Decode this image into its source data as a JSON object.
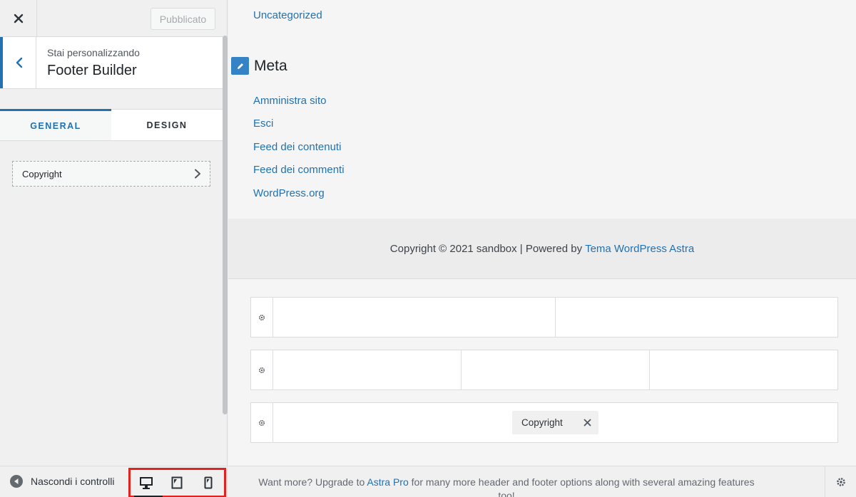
{
  "sidebar": {
    "publish_label": "Pubblicato",
    "section_sub": "Stai personalizzando",
    "section_title": "Footer Builder",
    "tabs": [
      {
        "label": "GENERAL",
        "active": true
      },
      {
        "label": "DESIGN",
        "active": false
      }
    ],
    "items": [
      {
        "label": "Copyright"
      }
    ],
    "hide_controls_label": "Nascondi i controlli"
  },
  "preview": {
    "category_link": "Uncategorized",
    "meta_heading": "Meta",
    "meta_links": [
      "Amministra sito",
      "Esci",
      "Feed dei contenuti",
      "Feed dei commenti",
      "WordPress.org"
    ],
    "footer_text": "Copyright © 2021 sandbox | Powered by",
    "footer_link": "Tema WordPress Astra",
    "builder_chip_label": "Copyright"
  },
  "promo": {
    "text_before": "Want more? Upgrade to",
    "link": "Astra Pro",
    "text_after": "for many more header and footer options along with several amazing features too!"
  },
  "colors": {
    "accent": "#2271b1",
    "highlight_border": "#e0231c"
  },
  "icons": [
    "close-icon",
    "chevron-left-icon",
    "chevron-right-icon",
    "circle-arrow-left-icon",
    "desktop-icon",
    "tablet-icon",
    "mobile-icon",
    "pencil-icon",
    "gear-icon",
    "x-icon"
  ]
}
